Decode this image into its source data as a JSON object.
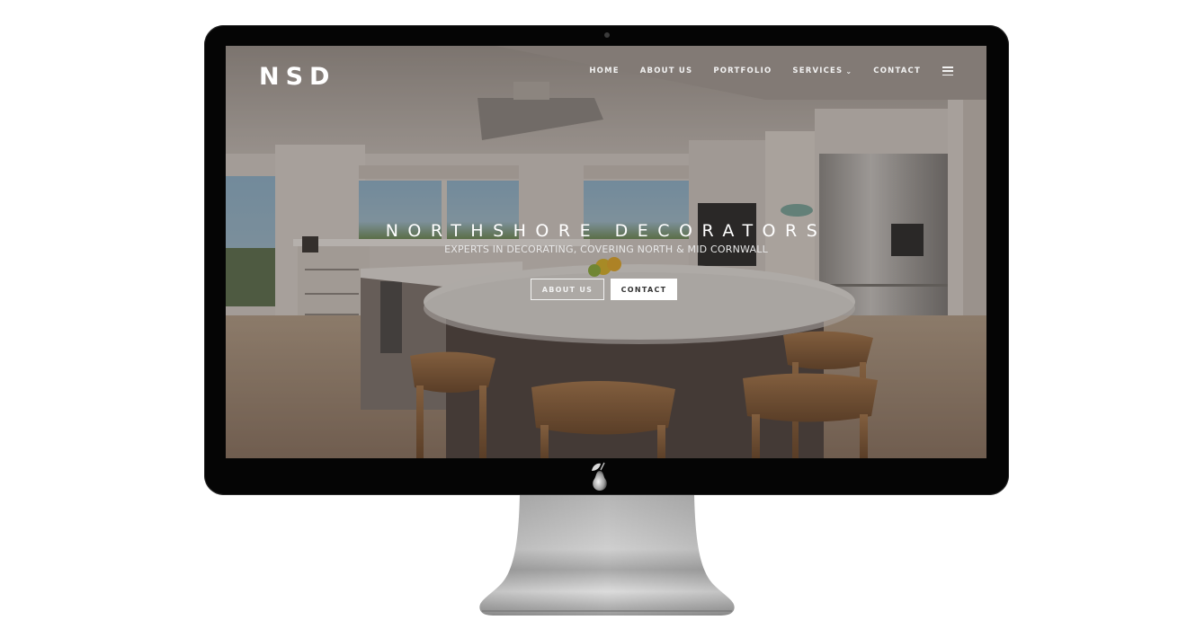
{
  "site": {
    "logo": "NSD",
    "nav": {
      "items": [
        {
          "label": "HOME"
        },
        {
          "label": "ABOUT US"
        },
        {
          "label": "PORTFOLIO"
        },
        {
          "label": "SERVICES"
        },
        {
          "label": "CONTACT"
        }
      ],
      "services_chevron": "›",
      "menu_icon": "hamburger-menu-icon"
    },
    "hero": {
      "title": "NORTHSHORE DECORATORS",
      "subtitle": "EXPERTS IN DECORATING, COVERING NORTH & MID CORNWALL",
      "buttons": {
        "about": "ABOUT US",
        "contact": "CONTACT"
      },
      "background_image": "kitchen interior with island and wooden stools"
    }
  },
  "device": {
    "type": "desktop monitor mockup",
    "logo_icon": "pear-icon"
  },
  "colors": {
    "page_background": "#ffffff",
    "bezel": "#050505",
    "nav_text": "#f2f2f2",
    "button_solid_bg": "#ffffff",
    "button_solid_text": "#333333"
  }
}
